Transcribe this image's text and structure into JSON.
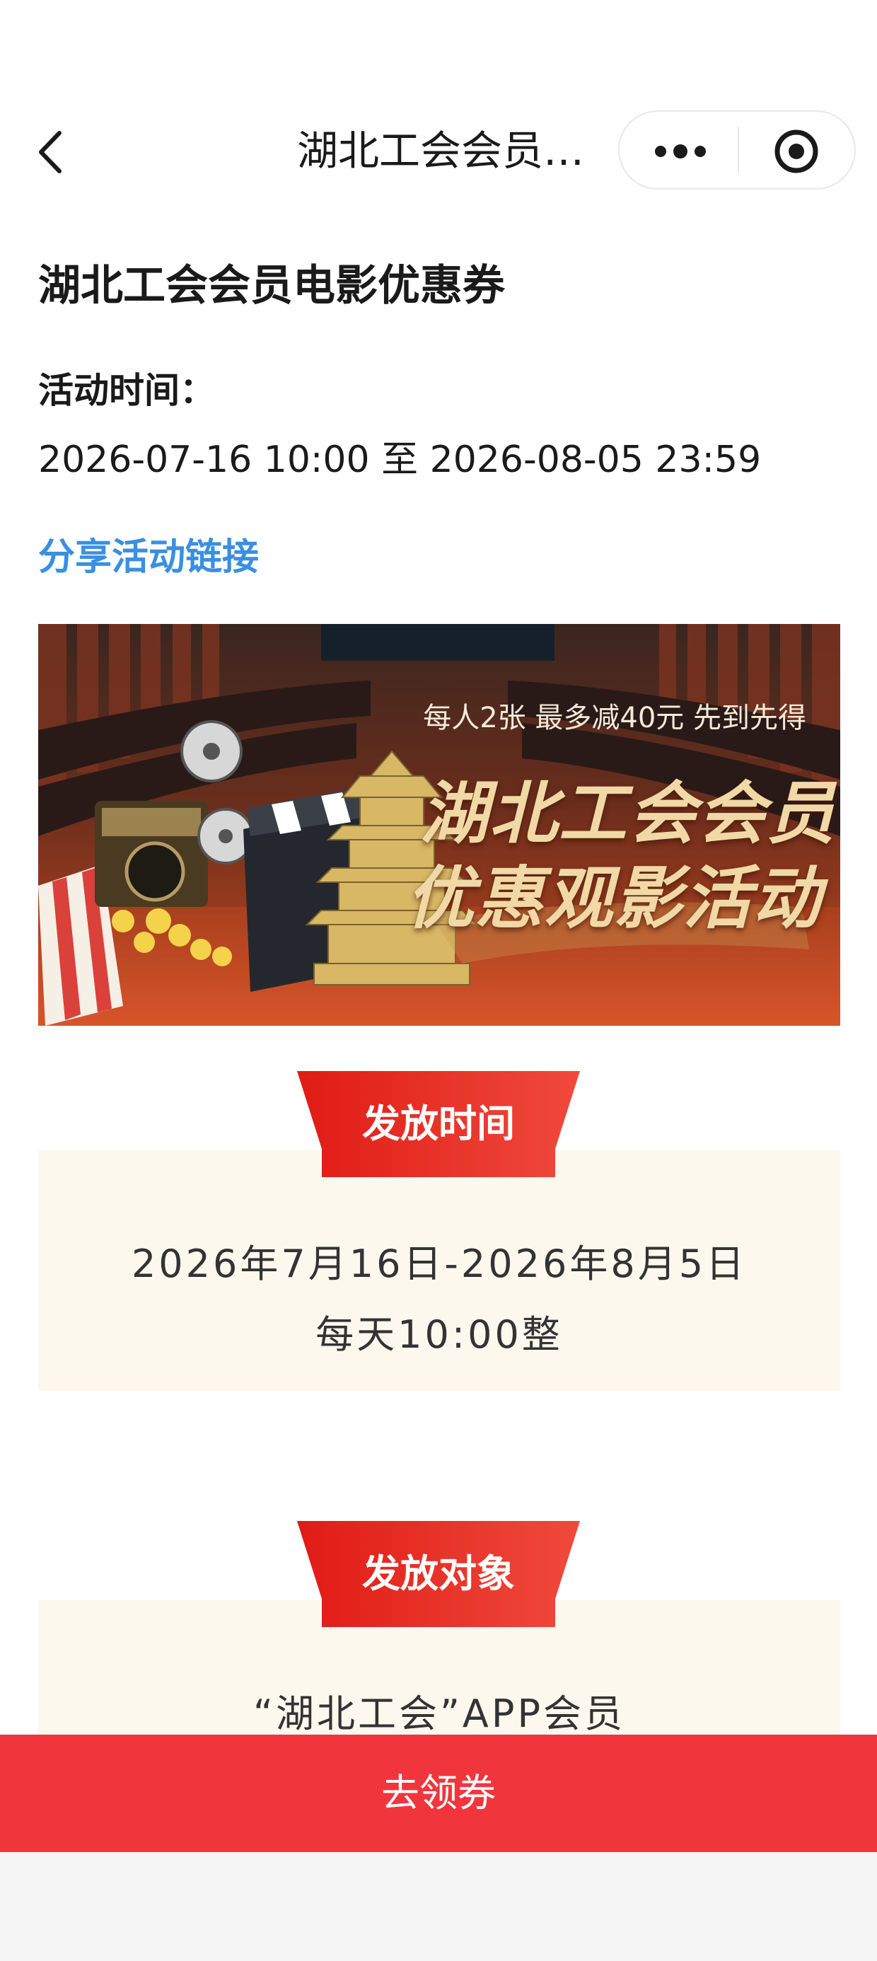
{
  "nav": {
    "title": "湖北工会会员…"
  },
  "header": {
    "title": "湖北工会会员电影优惠券",
    "time_label": "活动时间：",
    "time_range": "2026-07-16 10:00 至 2026-08-05 23:59",
    "share_link": "分享活动链接"
  },
  "banner": {
    "subtitle": "每人2张 最多减40元 先到先得",
    "headline_line1": "湖北工会会员",
    "headline_line2": "优惠观影活动"
  },
  "sections": [
    {
      "heading": "发放时间",
      "lines": [
        "2026年7月16日-2026年8月5日",
        "每天10:00整"
      ]
    },
    {
      "heading": "发放对象",
      "lines": [
        "“湖北工会”APP会员"
      ]
    }
  ],
  "cta": {
    "label": "去领券"
  },
  "colors": {
    "accent_red": "#f0363c",
    "link_blue": "#3a8fe0",
    "section_bg": "#fdf8ee"
  }
}
